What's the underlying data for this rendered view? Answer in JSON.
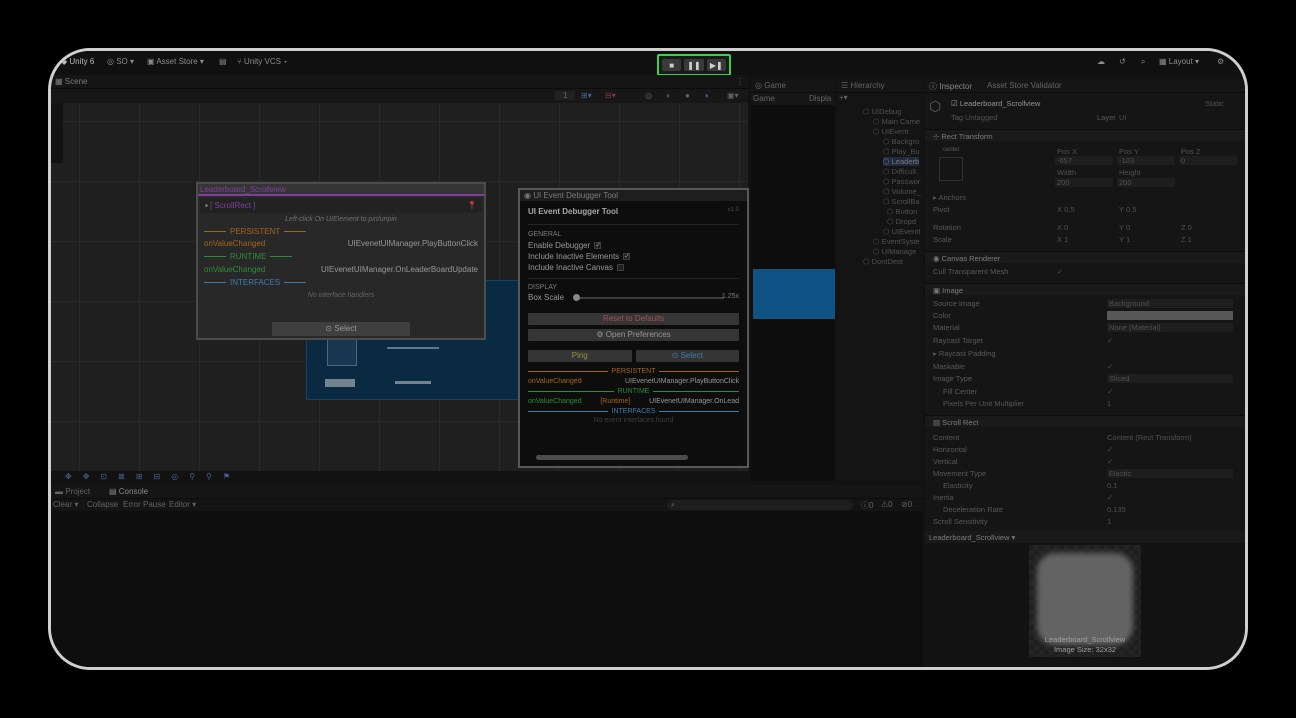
{
  "toolbar": {
    "unity": "Unity 6",
    "so": "SO",
    "asset_store": "Asset Store",
    "unity_vcs": "Unity VCS",
    "layout": "Layout"
  },
  "play": {
    "play": "■",
    "pause": "❚❚",
    "step": "▶❚"
  },
  "tabs": {
    "scene": "Scene",
    "game": "Game",
    "hierarchy": "Hierarchy",
    "inspector": "Inspector",
    "asset_validator": "Asset Store Validator",
    "project": "Project",
    "console": "Console"
  },
  "game": {
    "label": "Game",
    "display": "Displa"
  },
  "scene_toolbar": {
    "zoom": "1"
  },
  "popup1": {
    "title": "Leaderboard_Scrollview",
    "component": "[ ScrollRect ]",
    "hint": "Left-click On UIElement to pin/unpin",
    "persistent": "PERSISTENT",
    "runtime": "RUNTIME",
    "interfaces": "INTERFACES",
    "row1_event": "onValueChanged",
    "row1_handler": "UIEvenetUIManager.PlayButtonClick",
    "row2_event": "onValueChanged",
    "row2_handler": "UIEvenetUIManager.OnLeaderBoardUpdate",
    "no_interface": "No interface handlers",
    "select": "⊙ Select"
  },
  "popup2": {
    "window_title": "UI Event Debugger Tool",
    "title": "UI Event Debugger Tool",
    "version": "v1.0",
    "general": "GENERAL",
    "enable": "Enable Debugger",
    "inactive_elements": "Include Inactive Elements",
    "inactive_canvas": "Include Inactive Canvas",
    "display": "DISPLAY",
    "box_scale": "Box Scale",
    "box_scale_value": "1.25x",
    "box_scale_fraction": 0.0,
    "reset": "Reset to Defaults",
    "prefs": "Open Preferences",
    "ping": "Ping",
    "select": "⊙ Select",
    "persistent": "PERSISTENT",
    "runtime": "RUNTIME",
    "interfaces": "INTERFACES",
    "r1_event": "onValueChanged",
    "r1_handler": "UIEvenetUIManager.PlayButtonClick",
    "r2_event": "onValueChanged",
    "r2_tag": "[Runtime]",
    "r2_handler": "UIEvenetUIManager.OnLead",
    "no_interface": "No event interfaces found"
  },
  "hierarchy": [
    "UIDebug",
    "Main Came",
    "UIEvent",
    "Backgro",
    "Play_Bu",
    "Leaderb",
    "Difficult",
    "Passwor",
    "Volume_",
    "ScrollBa",
    "Button",
    "Dropd",
    "UIEventI",
    "EventSyste",
    "UIManage",
    "DontDest"
  ],
  "inspector": {
    "object_name": "Leaderboard_Scrollview",
    "static": "Static",
    "tag_label": "Tag",
    "tag_value": "Untagged",
    "layer_label": "Layer",
    "layer_value": "UI",
    "rect_transform": "Rect Transform",
    "center": "center",
    "posx_label": "Pos X",
    "posy_label": "Pos Y",
    "posz_label": "Pos Z",
    "posx": "-657",
    "posy": "-103",
    "posz": "0",
    "width_label": "Width",
    "height_label": "Height",
    "width": "200",
    "height": "200",
    "anchors": "Anchors",
    "pivot": "Pivot",
    "pivot_x": "0.5",
    "pivot_y": "0.5",
    "rotation": "Rotation",
    "rot_x": "0",
    "rot_y": "0",
    "rot_z": "0",
    "scale": "Scale",
    "scale_x": "1",
    "scale_y": "1",
    "scale_z": "1",
    "canvas_renderer": "Canvas Renderer",
    "cull": "Cull Transparent Mesh",
    "image": "Image",
    "source_image": "Source Image",
    "source_value": "Background",
    "color": "Color",
    "material": "Material",
    "material_value": "None (Material)",
    "raycast_target": "Raycast Target",
    "raycast_padding": "Raycast Padding",
    "maskable": "Maskable",
    "image_type": "Image Type",
    "image_type_value": "Sliced",
    "fill_center": "Fill Center",
    "ppu": "Pixels Per Unit Multiplier",
    "ppu_value": "1",
    "scroll_rect": "Scroll Rect",
    "content": "Content",
    "content_value": "Content (Rect Transform)",
    "horizontal": "Horizontal",
    "vertical": "Vertical",
    "movement": "Movement Type",
    "movement_value": "Elastic",
    "elasticity": "Elasticity",
    "elasticity_value": "0.1",
    "inertia": "Inertia",
    "decel": "Deceleration Rate",
    "decel_value": "0.135",
    "scroll_sens": "Scroll Sensitivity",
    "scroll_sens_value": "1",
    "preview_title": "Leaderboard_Scrollview",
    "preview_name": "Leaderboard_Scrollview",
    "preview_size": "Image Size: 32x32"
  },
  "console": {
    "clear": "Clear",
    "collapse": "Collapse",
    "error_pause": "Error Pause",
    "editor": "Editor",
    "c_info": "0",
    "c_warn": "0",
    "c_err": "0"
  }
}
